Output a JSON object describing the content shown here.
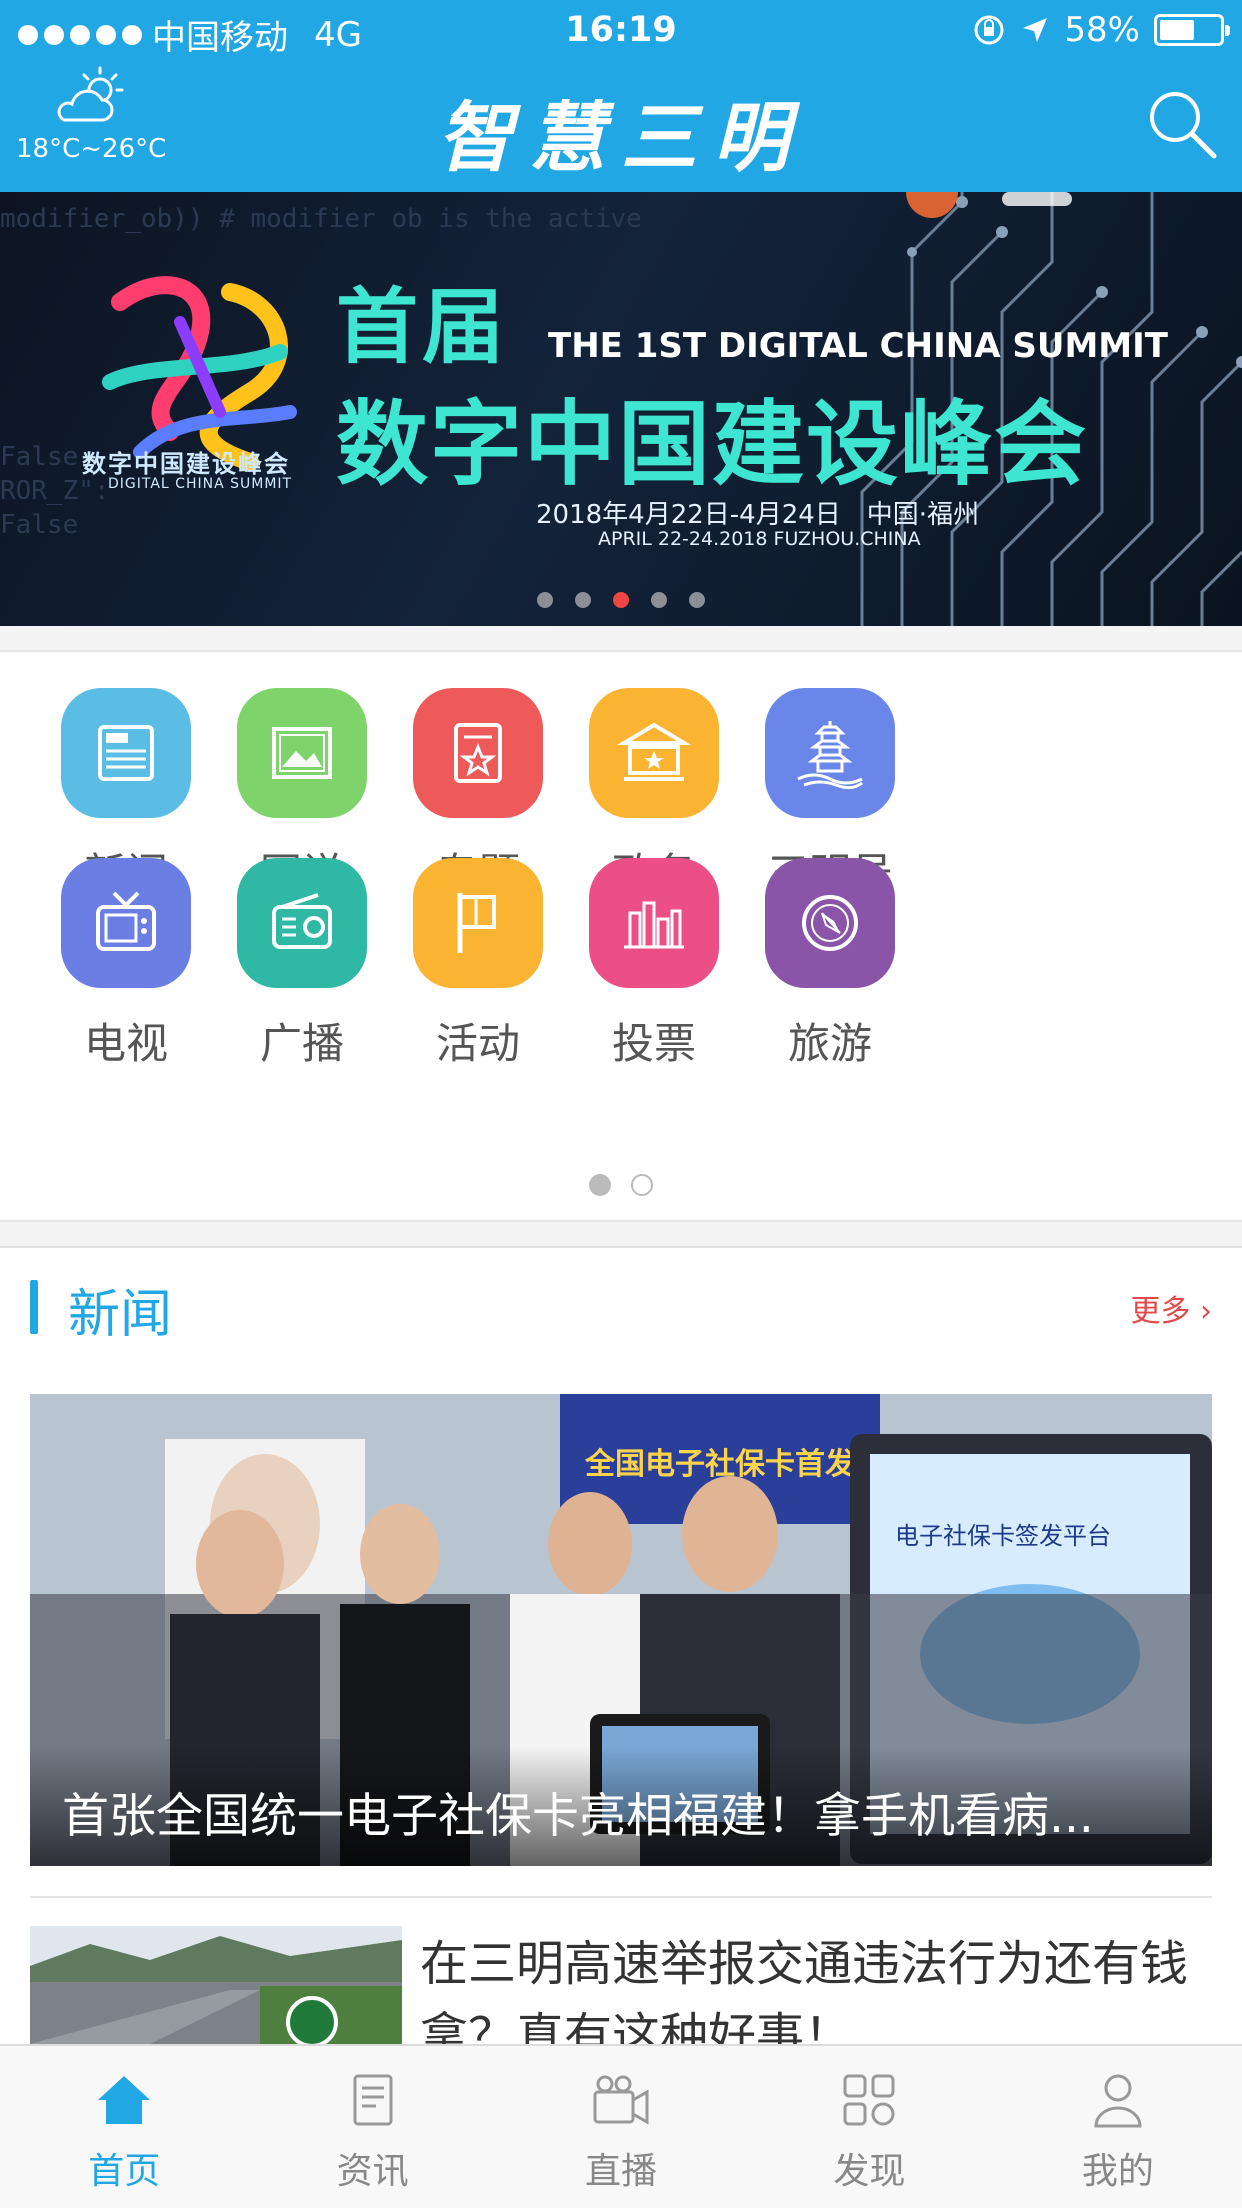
{
  "status_bar": {
    "carrier": "中国移动",
    "network": "4G",
    "time": "16:19",
    "battery": "58%",
    "battery_level": 0.58
  },
  "header": {
    "weather_icon": "cloud-sun-icon",
    "temperature": "18°C~26°C",
    "app_title": "智慧三明",
    "search_icon": "search-icon"
  },
  "banner": {
    "logo_text": "数字中国建设峰会",
    "logo_text_en": "DIGITAL CHINA SUMMIT",
    "headline_first": "首届",
    "headline_en": "THE 1ST DIGITAL CHINA SUMMIT",
    "headline_main": "数字中国建设峰会",
    "date": "2018年4月22日-4月24日　中国·福州",
    "date_en": "APRIL 22-24.2018 FUZHOU.CHINA",
    "code_lines": [
      "modifier_ob)) # modifier ob is the active",
      "",
      "",
      "",
      "",
      "",
      "",
      "False",
      "ROR_Z\":",
      "False"
    ],
    "slide_count": 5,
    "active_slide": 3
  },
  "grid": {
    "items": [
      {
        "label": "新闻",
        "icon": "news-icon",
        "color": "#5bbde4"
      },
      {
        "label": "图说",
        "icon": "picture-icon",
        "color": "#7ed36a"
      },
      {
        "label": "专题",
        "icon": "topic-icon",
        "color": "#ee5a5a"
      },
      {
        "label": "政务",
        "icon": "government-icon",
        "color": "#fbb332"
      },
      {
        "label": "三明号",
        "icon": "pagoda-icon",
        "color": "#6a86e8"
      },
      {
        "label": "电视",
        "icon": "tv-icon",
        "color": "#6a7ee3"
      },
      {
        "label": "广播",
        "icon": "radio-icon",
        "color": "#2fb8a3"
      },
      {
        "label": "活动",
        "icon": "flag-icon",
        "color": "#fbb332"
      },
      {
        "label": "投票",
        "icon": "vote-icon",
        "color": "#ec4f86"
      },
      {
        "label": "旅游",
        "icon": "compass-icon",
        "color": "#8a55a8"
      }
    ],
    "page_count": 2,
    "active_page": 1
  },
  "news": {
    "section_title": "新闻",
    "more_label": "更多 ›",
    "hero_title": "首张全国统一电子社保卡亮相福建！拿手机看病...",
    "hero_sign_text": "全国电子社保卡首发",
    "hero_screen_text": "电子社保卡签发平台",
    "item_title": "在三明高速举报交通违法行为还有钱拿？真有这种好事！"
  },
  "tabbar": {
    "tabs": [
      {
        "label": "首页",
        "icon": "home-icon",
        "active": true
      },
      {
        "label": "资讯",
        "icon": "document-icon",
        "active": false
      },
      {
        "label": "直播",
        "icon": "video-camera-icon",
        "active": false
      },
      {
        "label": "发现",
        "icon": "grid-apps-icon",
        "active": false
      },
      {
        "label": "我的",
        "icon": "user-icon",
        "active": false
      }
    ]
  },
  "colors": {
    "brand": "#22a7e5",
    "accent_red": "#e24a4a",
    "banner_teal": "#3ee6d2"
  }
}
